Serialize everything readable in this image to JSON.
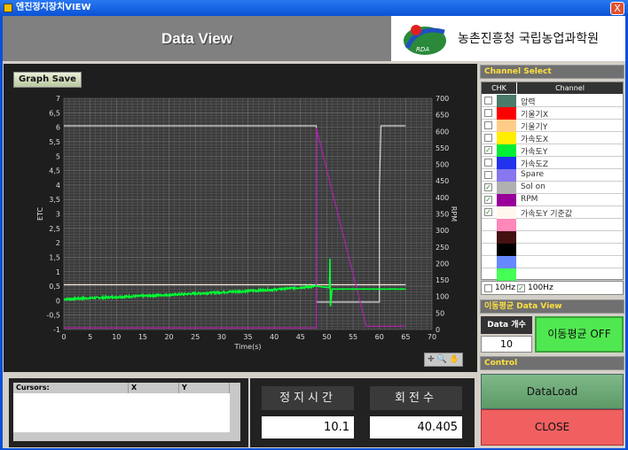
{
  "window": {
    "title": "엔진정지장치VIEW",
    "close": "X"
  },
  "header": {
    "title": "Data View",
    "org": "농촌진흥청 국립농업과학원",
    "logo_text": "RDA"
  },
  "graph": {
    "save_label": "Graph Save",
    "tools": "✛ 🔍 ✋"
  },
  "chart_data": {
    "type": "line",
    "xlabel": "Time(s)",
    "ylabel": "ETC",
    "y2label": "RPM",
    "xlim": [
      0,
      70
    ],
    "ylim": [
      -1,
      7
    ],
    "y2lim": [
      0,
      700
    ],
    "xticks": [
      "0",
      "5",
      "10",
      "15",
      "20",
      "25",
      "30",
      "35",
      "40",
      "45",
      "50",
      "55",
      "60",
      "65",
      "70"
    ],
    "yticks": [
      "-1",
      "-0,5",
      "0",
      "0,5",
      "1",
      "1,5",
      "2",
      "2,5",
      "3",
      "3,5",
      "4",
      "4,5",
      "5",
      "5,5",
      "6",
      "6,5",
      "7"
    ],
    "y2ticks": [
      "0",
      "50",
      "100",
      "150",
      "200",
      "250",
      "300",
      "350",
      "400",
      "450",
      "500",
      "550",
      "600",
      "650",
      "700"
    ],
    "grid": true,
    "series": [
      {
        "name": "Sol on",
        "color": "#d8d8d8",
        "axis": "left",
        "points": [
          [
            0,
            6.05
          ],
          [
            48,
            6.05
          ],
          [
            48,
            -0.05
          ],
          [
            60,
            -0.05
          ],
          [
            60,
            3.8
          ],
          [
            60.3,
            6.05
          ],
          [
            65,
            6.05
          ]
        ]
      },
      {
        "name": "가속도Y 기준값",
        "color": "#fff0e0",
        "axis": "left",
        "points": [
          [
            0,
            0.55
          ],
          [
            65,
            0.55
          ]
        ]
      },
      {
        "name": "RPM",
        "color": "#b020b0",
        "axis": "right",
        "points": [
          [
            0,
            5
          ],
          [
            48,
            5
          ],
          [
            48,
            610
          ],
          [
            57.5,
            10
          ],
          [
            65,
            10
          ]
        ]
      },
      {
        "name": "가속도Y",
        "color": "#00ff33",
        "axis": "left",
        "points": [
          [
            0,
            0.05
          ],
          [
            20,
            0.2
          ],
          [
            40,
            0.38
          ],
          [
            48,
            0.5
          ],
          [
            50.5,
            0.45
          ],
          [
            50.6,
            1.45
          ],
          [
            50.7,
            -0.2
          ],
          [
            51,
            0.4
          ],
          [
            65,
            0.4
          ]
        ]
      }
    ]
  },
  "channel_select": {
    "title": "Channel Select",
    "col_chk": "CHK",
    "col_channel": "Channel",
    "rows": [
      {
        "label": "압력",
        "color": "#4a7a6a",
        "checked": false
      },
      {
        "label": "기울기X",
        "color": "#ff0000",
        "checked": false
      },
      {
        "label": "기울기Y",
        "color": "#ffcc88",
        "checked": false
      },
      {
        "label": "가속도X",
        "color": "#ffee00",
        "checked": false
      },
      {
        "label": "가속도Y",
        "color": "#00ee33",
        "checked": true
      },
      {
        "label": "가속도Z",
        "color": "#2233ee",
        "checked": false
      },
      {
        "label": "Spare",
        "color": "#8877ee",
        "checked": false
      },
      {
        "label": "Sol on",
        "color": "#b0b0b0",
        "checked": true
      },
      {
        "label": "RPM",
        "color": "#990099",
        "checked": true
      },
      {
        "label": "가속도Y  기준값",
        "color": "#fff8ee",
        "checked": true
      },
      {
        "label": "",
        "color": "#ff88bb",
        "checked": null
      },
      {
        "label": "",
        "color": "#441111",
        "checked": null
      },
      {
        "label": "",
        "color": "#000000",
        "checked": null
      },
      {
        "label": "",
        "color": "#6688ff",
        "checked": null
      },
      {
        "label": "",
        "color": "#44ff55",
        "checked": null
      }
    ],
    "hz10": {
      "label": "10Hz",
      "checked": false
    },
    "hz100": {
      "label": "100Hz",
      "checked": true
    }
  },
  "moving_avg": {
    "title": "이동평균 Data View",
    "count_label": "Data 개수",
    "count_value": "10",
    "toggle_label": "이동평균 OFF"
  },
  "control": {
    "title": "Control",
    "dataload": "DataLoad",
    "close": "CLOSE"
  },
  "cursors": {
    "col_name": "Cursors:",
    "col_x": "X",
    "col_y": "Y"
  },
  "stats": {
    "stop_time_label": "정지시간",
    "stop_time_value": "10.1",
    "rev_label": "회전수",
    "rev_value": "40.405"
  }
}
